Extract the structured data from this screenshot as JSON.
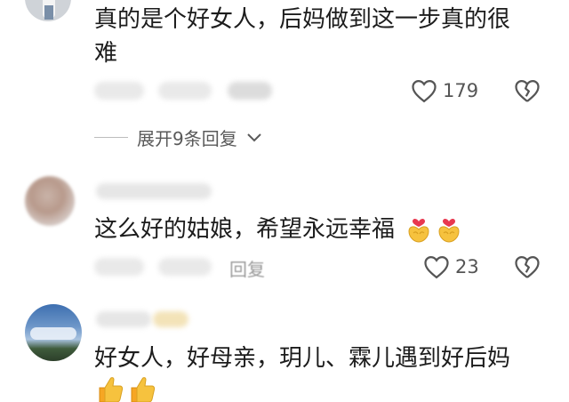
{
  "comments": [
    {
      "text_line1": "真的是个好女人，后妈做到这一步真的很",
      "text_line2": "难",
      "likes": "179",
      "expand_replies": "展开9条回复"
    },
    {
      "text": "这么好的姑娘，希望永远幸福",
      "likes": "23",
      "reply_label": "回复",
      "emoji_icon": "heart-hands-icon"
    },
    {
      "text": "好女人，好母亲，玥儿、霖儿遇到好后妈",
      "emoji_icon": "thumbs-up-icon"
    }
  ]
}
